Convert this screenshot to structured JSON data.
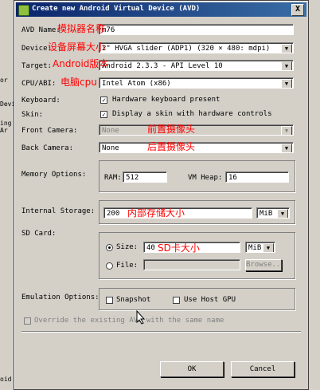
{
  "background_window": {
    "fragments": [
      "or",
      "Devi",
      "ing Ar",
      "oid"
    ]
  },
  "dialog": {
    "title": "Create new Android Virtual Device (AVD)",
    "close_label": "X"
  },
  "form": {
    "avd_name": {
      "label": "AVD Name:",
      "value": "m76"
    },
    "device": {
      "label": "Device:",
      "value": "2\" HVGA slider (ADP1) (320 × 480: mdpi)"
    },
    "target": {
      "label": "Target:",
      "value": "Android 2.3.3 - API Level 10"
    },
    "cpu_abi": {
      "label": "CPU/ABI:",
      "value": "Intel Atom (x86)"
    },
    "keyboard": {
      "label": "Keyboard:",
      "checkbox_label": "Hardware keyboard present",
      "checked": true
    },
    "skin": {
      "label": "Skin:",
      "checkbox_label": "Display a skin with hardware controls",
      "checked": true
    },
    "front_camera": {
      "label": "Front Camera:",
      "value": "None"
    },
    "back_camera": {
      "label": "Back Camera:",
      "value": "None"
    },
    "memory": {
      "label": "Memory Options:",
      "ram_label": "RAM:",
      "ram_value": "512",
      "vm_heap_label": "VM Heap:",
      "vm_heap_value": "16"
    },
    "internal_storage": {
      "label": "Internal Storage:",
      "value": "200",
      "unit": "MiB"
    },
    "sd_card": {
      "label": "SD Card:",
      "size_label": "Size:",
      "size_value": "40",
      "size_unit": "MiB",
      "file_label": "File:",
      "browse_label": "Browse..."
    },
    "emulation": {
      "label": "Emulation Options:",
      "snapshot_label": "Snapshot",
      "host_gpu_label": "Use Host GPU"
    },
    "override_label": "Override the existing AVD with the same name"
  },
  "buttons": {
    "ok": "OK",
    "cancel": "Cancel"
  },
  "annotations": {
    "avd_name": "模拟器名称",
    "device": "设备屏幕大小",
    "target": "Android版本",
    "cpu": "电脑cpu",
    "front_camera": "前置摄像头",
    "back_camera": "后置摄像头",
    "internal_storage": "内部存储大小",
    "sd_card": "SD卡大小"
  },
  "colors": {
    "annotation": "#ff0000",
    "title_bar": "#0a246a"
  }
}
